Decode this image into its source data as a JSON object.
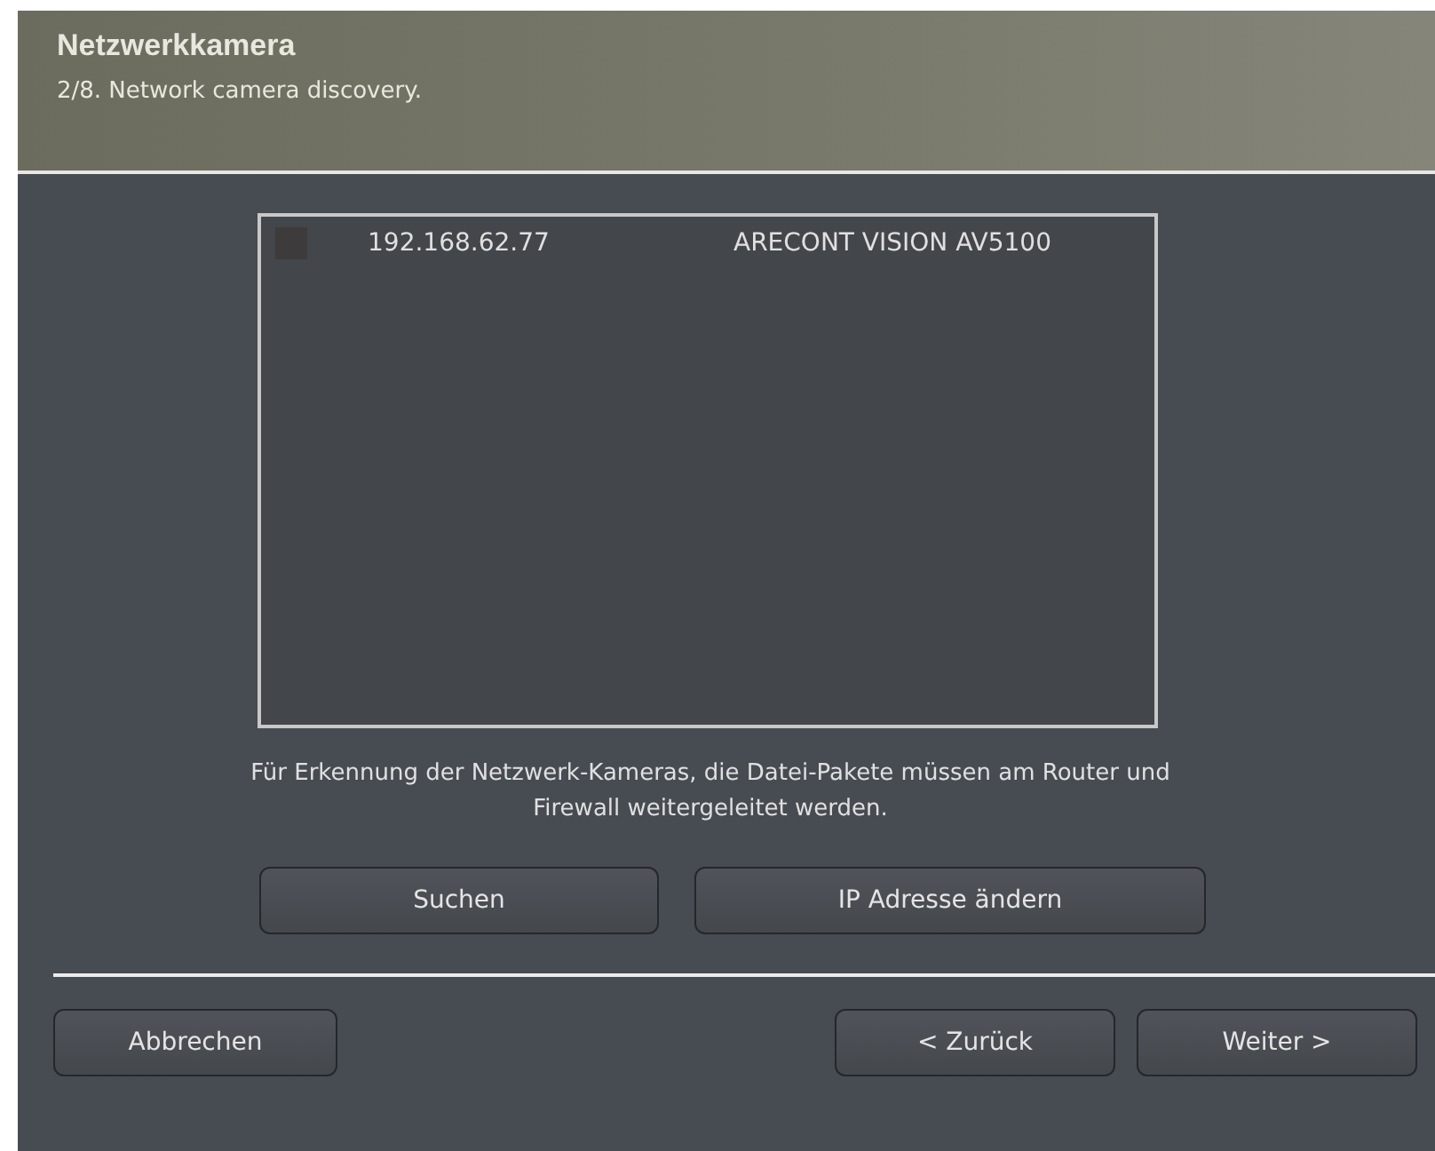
{
  "header": {
    "title": "Netzwerkkamera",
    "subtitle": "2/8. Network camera discovery."
  },
  "cameras": [
    {
      "checked": false,
      "ip": "192.168.62.77",
      "model": "ARECONT VISION AV5100"
    }
  ],
  "hint": "Für Erkennung der Netzwerk-Kameras, die Datei-Pakete müssen am Router und Firewall weitergeleitet werden.",
  "actions": [
    "Suchen",
    "IP Adresse ändern"
  ],
  "footer": {
    "cancel": "Abbrechen",
    "back": "< Zurück",
    "next": "Weiter >"
  }
}
